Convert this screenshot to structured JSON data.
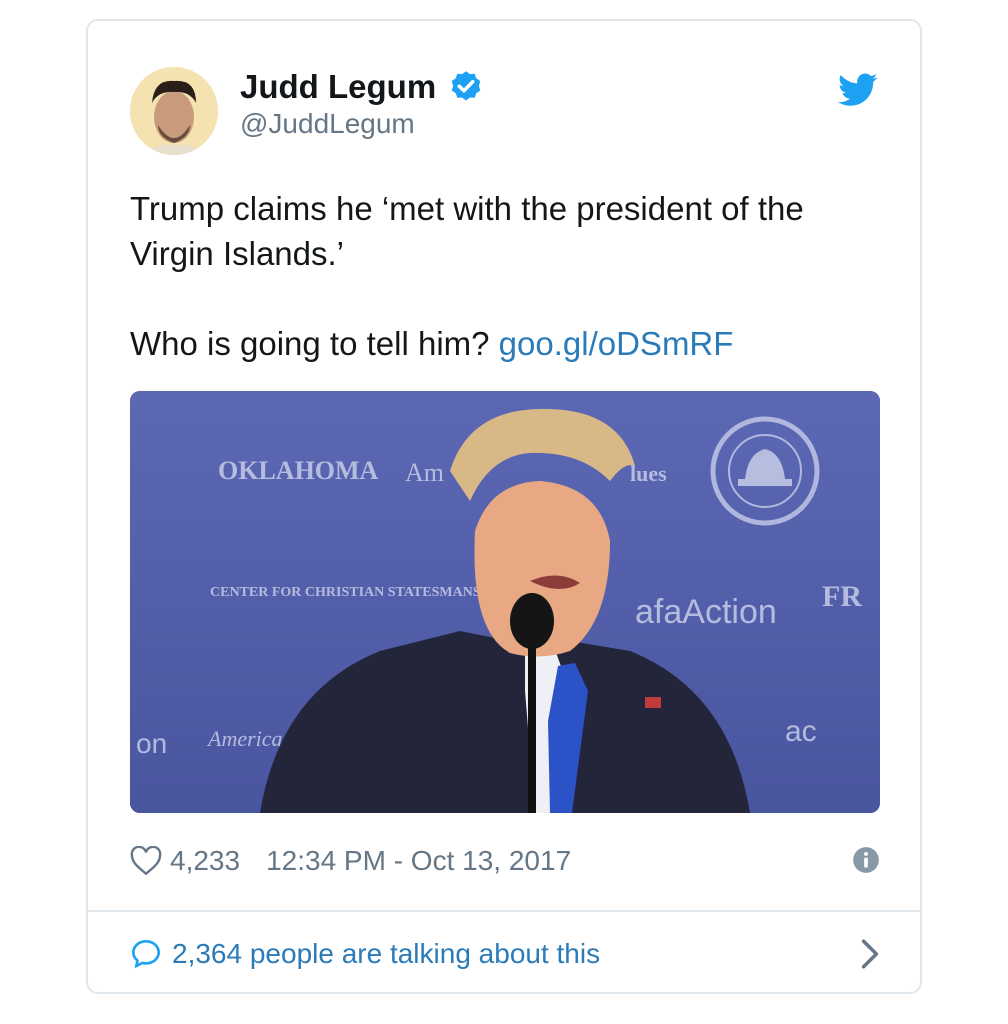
{
  "author": {
    "display_name": "Judd Legum",
    "handle": "@JuddLegum",
    "verified": true
  },
  "tweet": {
    "line1": "Trump claims he ‘met with the president of the Virgin Islands.’",
    "line2_prefix": "Who is going to tell him? ",
    "link_text": "goo.gl/oDSmRF"
  },
  "media": {
    "backdrop_logos": [
      "OKLAHOMA",
      "Am",
      "lues",
      "CENTER FOR CHRISTIAN STATESMANSHIP",
      "afaAction",
      "FR",
      "on",
      "America",
      "ac"
    ]
  },
  "meta": {
    "likes": "4,233",
    "timestamp": "12:34 PM - Oct 13, 2017"
  },
  "footer": {
    "talking_text": "2,364 people are talking about this"
  },
  "colors": {
    "twitter_blue": "#1da1f2",
    "link_blue": "#2b7bb9",
    "text": "#14171a",
    "muted": "#657786",
    "border": "#e1e8ed"
  },
  "icons": {
    "verified": "verified-badge-icon",
    "brand": "twitter-bird-icon",
    "like": "heart-icon",
    "info": "info-icon",
    "reply": "speech-bubble-icon",
    "more": "chevron-right-icon"
  }
}
